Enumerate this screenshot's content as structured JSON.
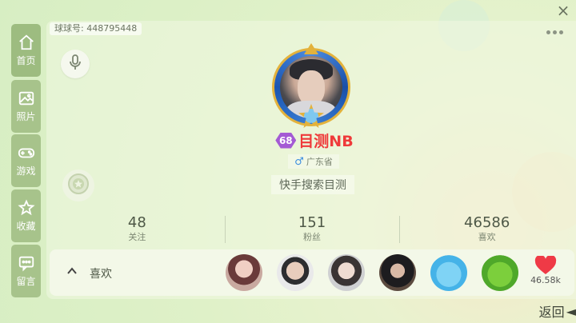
{
  "close_label": "×",
  "uid": "球球号: 448795448",
  "sidebar": {
    "items": [
      {
        "label": "首页",
        "icon": "home-icon"
      },
      {
        "label": "照片",
        "icon": "photo-icon"
      },
      {
        "label": "游戏",
        "icon": "gamepad-icon"
      },
      {
        "label": "收藏",
        "icon": "star-collection-icon"
      },
      {
        "label": "留言",
        "icon": "message-icon"
      }
    ]
  },
  "profile": {
    "level": "68",
    "nickname": "目测NB",
    "gender_symbol": "♂",
    "location": "广东省",
    "search_hint": "快手搜索目测"
  },
  "stats": [
    {
      "value": "48",
      "label": "关注"
    },
    {
      "value": "151",
      "label": "粉丝"
    },
    {
      "value": "46586",
      "label": "喜欢"
    }
  ],
  "likes": {
    "chevron": "^",
    "label": "喜欢",
    "count": "46.58k"
  },
  "back_label": "返回",
  "back_arrow": "◄",
  "colors": {
    "accent_red": "#ef3a3a",
    "sidebar_green": "#a7c38b",
    "level_purple": "#a45ad4"
  }
}
